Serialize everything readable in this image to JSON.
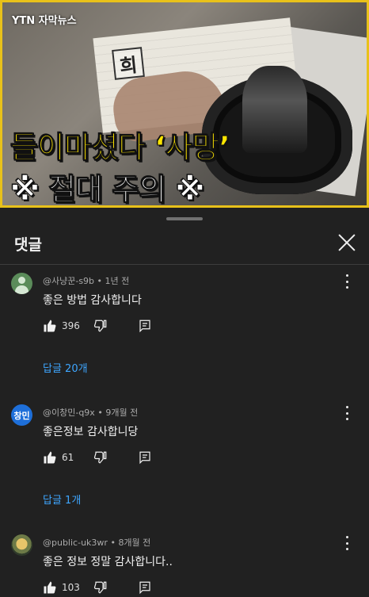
{
  "video": {
    "brand": "YTN 자막뉴스",
    "paper_glyph": "희",
    "headline": "들이마셨다 ‘사망’",
    "subline": "※ 절대 주의 ※"
  },
  "sheet": {
    "title": "댓글"
  },
  "comments": [
    {
      "author": "@사냥꾼-s9b",
      "time": "1년 전",
      "text": "좋은 방법 감사합니다",
      "likes": "396",
      "replies_label": "답글 20개",
      "avatar_type": "person"
    },
    {
      "author": "@이창민-q9x",
      "time": "9개월 전",
      "text": "좋은정보 감사합니당",
      "likes": "61",
      "replies_label": "답글 1개",
      "avatar_type": "initials",
      "avatar_text": "창민"
    },
    {
      "author": "@public-uk3wr",
      "time": "8개월 전",
      "text": "좋은 정보 정말 감사합니다..",
      "likes": "103",
      "avatar_type": "photo"
    }
  ],
  "colors": {
    "background": "#0f0f0f",
    "sheet": "#212121",
    "link": "#3ea6ff",
    "headline": "#ffe600",
    "frame": "#e8c11a"
  }
}
